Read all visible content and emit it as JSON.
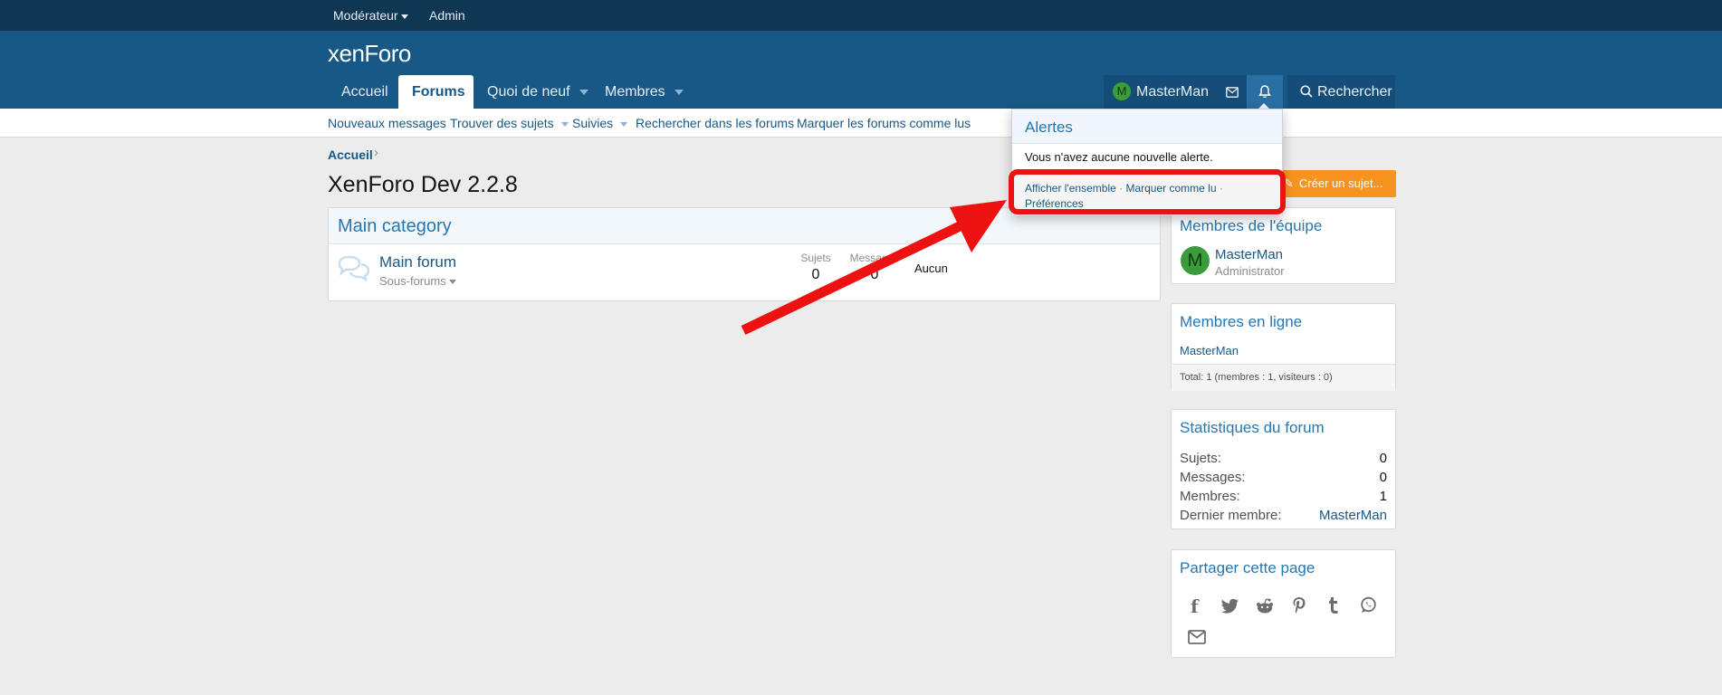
{
  "staffbar": {
    "moderator": "Modérateur",
    "admin": "Admin"
  },
  "header": {
    "logo_a": "xen",
    "logo_b": "Foro"
  },
  "nav": {
    "tabs": [
      {
        "label": "Accueil"
      },
      {
        "label": "Forums"
      },
      {
        "label": "Quoi de neuf"
      },
      {
        "label": "Membres"
      }
    ],
    "account": {
      "avatar_letter": "M",
      "username": "MasterMan",
      "search": "Rechercher"
    }
  },
  "subnav": {
    "items": [
      "Nouveaux messages",
      "Trouver des sujets",
      "Suivies",
      "Rechercher dans les forums",
      "Marquer les forums comme lus"
    ]
  },
  "breadcrumb": {
    "home": "Accueil",
    "separator": "›"
  },
  "page_title": "XenForo Dev 2.2.8",
  "category": {
    "title": "Main category",
    "forum_name": "Main forum",
    "subforums": "Sous-forums",
    "stat_topics_label": "Sujets",
    "stat_topics": "0",
    "stat_messages_label": "Messages",
    "stat_messages": "0",
    "last_post": "Aucun"
  },
  "create_thread": "Créer un sujet...",
  "staff_block": {
    "title": "Membres de l'équipe",
    "avatar_letter": "M",
    "name": "MasterMan",
    "role": "Administrator"
  },
  "online_block": {
    "title": "Membres en ligne",
    "member": "MasterMan",
    "total": "Total: 1 (membres : 1, visiteurs : 0)"
  },
  "stats_block": {
    "title": "Statistiques du forum",
    "rows": [
      {
        "label": "Sujets:",
        "value": "0"
      },
      {
        "label": "Messages:",
        "value": "0"
      },
      {
        "label": "Membres:",
        "value": "1"
      },
      {
        "label": "Dernier membre:",
        "value": "MasterMan"
      }
    ]
  },
  "share_block": {
    "title": "Partager cette page"
  },
  "alerts": {
    "title": "Alertes",
    "empty": "Vous n'avez aucune nouvelle alerte.",
    "view_all": "Afficher l'ensemble",
    "mark_read": "Marquer comme lu",
    "preferences": "Préférences",
    "sep": " · "
  },
  "colors": {
    "header": "#185886",
    "staffbar": "#0f3652",
    "accent": "#2577b1",
    "create_button": "#f7931e",
    "annotation": "#ee1111"
  }
}
